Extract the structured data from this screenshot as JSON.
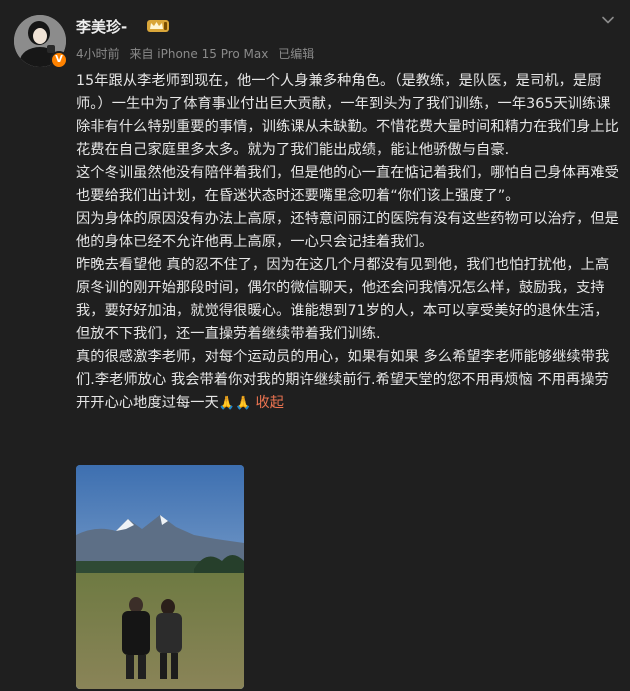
{
  "post": {
    "author": "李美珍-",
    "vip_badge": "V",
    "time": "4小时前",
    "source": "来自 iPhone 15 Pro Max",
    "edited": "已编辑",
    "paragraphs": [
      "15年跟从李老师到现在，他一个人身兼多种角色。（是教练，是队医，是司机，是厨师。）一生中为了体育事业付出巨大贡献，一年到头为了我们训练，一年365天训练课除非有什么特别重要的事情，训练课从未缺勤。不惜花费大量时间和精力在我们身上比花费在自己家庭里多太多。就为了我们能出成绩，能让他骄傲与自豪.",
      "这个冬训虽然他没有陪伴着我们，但是他的心一直在惦记着我们，哪怕自己身体再难受也要给我们出计划，在昏迷状态时还要嘴里念叨着“你们该上强度了”。",
      "因为身体的原因没有办法上高原，还特意问丽江的医院有没有这些药物可以治疗，但是他的身体已经不允许他再上高原，一心只会记挂着我们。",
      "昨晚去看望他 真的忍不住了，因为在这几个月都没有见到他，我们也怕打扰他，上高原冬训的刚开始那段时间，偶尔的微信聊天，他还会问我情况怎么样，鼓励我，支持我，要好好加油，就觉得很暖心。谁能想到71岁的人，本可以享受美好的退休生活，但放不下我们，还一直操劳着继续带着我们训练.",
      "真的很感激李老师，对每个运动员的用心，如果有如果 多么希望李老师能够继续带我们.李老师放心 我会带着你对我的期许继续前行.希望天堂的您不用再烦恼 不用再操劳 开开心心地度过每一天"
    ],
    "trailing_emoji": "🙏🙏",
    "collapse_label": "收起"
  },
  "icons": {
    "avatar": "avatar-photo",
    "level": "crown-level-badge",
    "menu": "chevron-down-icon",
    "photo": "two-athletes-mountain-photo"
  },
  "colors": {
    "background": "#1f1f1f",
    "text": "#e6e6e6",
    "meta": "#8a8a8a",
    "link": "#eb7350",
    "vip": "#ff8200"
  }
}
